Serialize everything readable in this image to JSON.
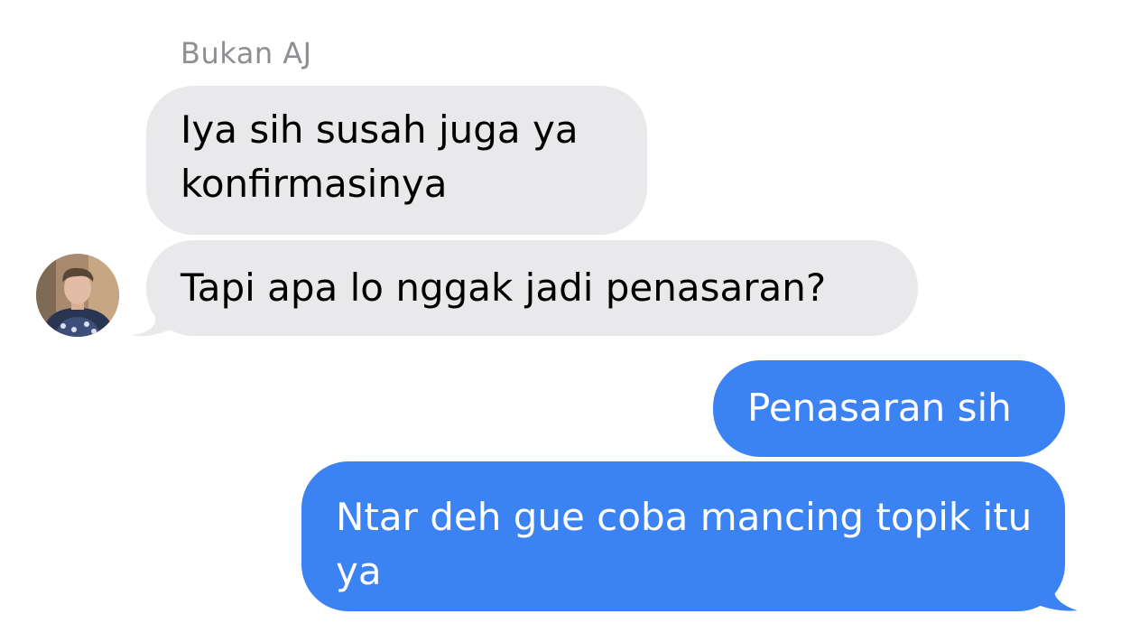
{
  "conversation": {
    "sender_name": "Bukan AJ",
    "messages": [
      {
        "direction": "incoming",
        "text": "Iya sih susah juga ya konfirmasinya"
      },
      {
        "direction": "incoming",
        "text": "Tapi apa lo nggak jadi penasaran?"
      },
      {
        "direction": "outgoing",
        "text": "Penasaran sih"
      },
      {
        "direction": "outgoing",
        "text": "Ntar deh gue coba mancing topik itu ya"
      }
    ]
  },
  "colors": {
    "incoming_bubble": "#e9e9eb",
    "outgoing_bubble": "#3b82f2",
    "sender_name": "#8e8e93"
  },
  "icons": {
    "avatar": "contact-avatar-photo"
  }
}
